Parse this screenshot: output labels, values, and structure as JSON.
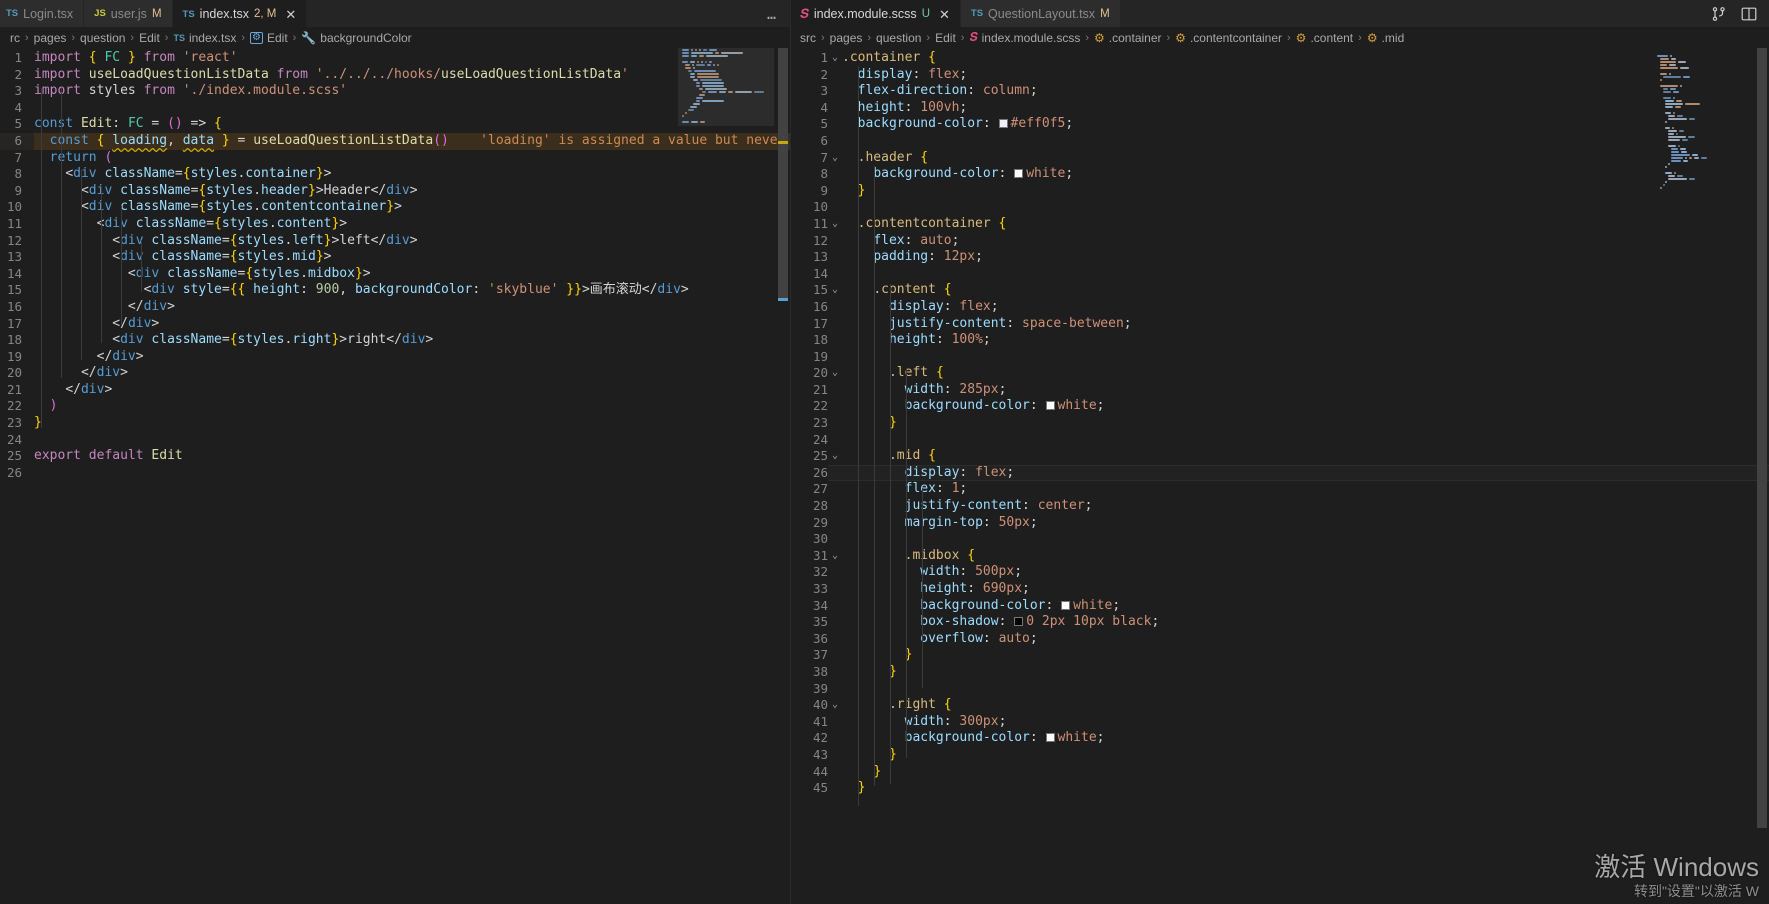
{
  "window": {
    "icons": [
      {
        "name": "source-control-icon",
        "glyph": "source-control"
      },
      {
        "name": "split-editor-icon",
        "glyph": "split-editor"
      }
    ]
  },
  "watermark": {
    "line1": "激活 Windows",
    "line2": "转到\"设置\"以激活 W"
  },
  "left_group": {
    "more_actions_label": "…",
    "tabs": [
      {
        "name": "tab-login-tsx",
        "icon": "ts-file-icon",
        "icon_kind": "ts",
        "label": "Login.tsx",
        "mark": "",
        "active": false,
        "closable": false
      },
      {
        "name": "tab-user-js",
        "icon": "js-file-icon",
        "icon_kind": "js",
        "label": "user.js",
        "mark": "M",
        "mark_kind": "m",
        "active": false,
        "closable": false
      },
      {
        "name": "tab-index-tsx",
        "icon": "ts-file-icon",
        "icon_kind": "ts",
        "label": "index.tsx",
        "mark": "2, M",
        "mark_kind": "m",
        "active": true,
        "closable": true
      }
    ],
    "breadcrumb": [
      {
        "name": "crumb-src",
        "label": "rc",
        "icon": ""
      },
      {
        "name": "crumb-pages",
        "label": "pages",
        "icon": ""
      },
      {
        "name": "crumb-question",
        "label": "question",
        "icon": ""
      },
      {
        "name": "crumb-edit-folder",
        "label": "Edit",
        "icon": ""
      },
      {
        "name": "crumb-index-tsx",
        "label": "index.tsx",
        "icon": "ts"
      },
      {
        "name": "crumb-symbol-edit",
        "label": "Edit",
        "icon": "box"
      },
      {
        "name": "crumb-symbol-backgroundcolor",
        "label": "backgroundColor",
        "icon": "wrench"
      }
    ],
    "warning_text": "'loading' is assigned a value but neve",
    "code": [
      {
        "n": 1,
        "t": "import { FC } from 'react'"
      },
      {
        "n": 2,
        "t": "import useLoadQuestionListData from '../../../hooks/useLoadQuestionListData'"
      },
      {
        "n": 3,
        "t": "import styles from './index.module.scss'"
      },
      {
        "n": 4,
        "t": ""
      },
      {
        "n": 5,
        "t": "const Edit: FC = () => {"
      },
      {
        "n": 6,
        "t": "  const { loading, data } = useLoadQuestionListData()"
      },
      {
        "n": 7,
        "t": "  return ("
      },
      {
        "n": 8,
        "t": "    <div className={styles.container}>"
      },
      {
        "n": 9,
        "t": "      <div className={styles.header}>Header</div>"
      },
      {
        "n": 10,
        "t": "      <div className={styles.contentcontainer}>"
      },
      {
        "n": 11,
        "t": "        <div className={styles.content}>"
      },
      {
        "n": 12,
        "t": "          <div className={styles.left}>left</div>"
      },
      {
        "n": 13,
        "t": "          <div className={styles.mid}>"
      },
      {
        "n": 14,
        "t": "            <div className={styles.midbox}>"
      },
      {
        "n": 15,
        "t": "              <div style={{ height: 900, backgroundColor: 'skyblue' }}>画布滚动</div>"
      },
      {
        "n": 16,
        "t": "            </div>"
      },
      {
        "n": 17,
        "t": "          </div>"
      },
      {
        "n": 18,
        "t": "          <div className={styles.right}>right</div>"
      },
      {
        "n": 19,
        "t": "        </div>"
      },
      {
        "n": 20,
        "t": "      </div>"
      },
      {
        "n": 21,
        "t": "    </div>"
      },
      {
        "n": 22,
        "t": "  )"
      },
      {
        "n": 23,
        "t": "}"
      },
      {
        "n": 24,
        "t": ""
      },
      {
        "n": 25,
        "t": "export default Edit"
      },
      {
        "n": 26,
        "t": ""
      }
    ]
  },
  "right_group": {
    "tabs": [
      {
        "name": "tab-index-module-scss",
        "icon": "scss-file-icon",
        "icon_kind": "scss",
        "label": "index.module.scss",
        "mark": "U",
        "mark_kind": "u",
        "active": true,
        "closable": true
      },
      {
        "name": "tab-questionlayout-tsx",
        "icon": "ts-file-icon",
        "icon_kind": "ts",
        "label": "QuestionLayout.tsx",
        "mark": "M",
        "mark_kind": "m",
        "active": false,
        "closable": false
      }
    ],
    "breadcrumb": [
      {
        "name": "crumb-src",
        "label": "src",
        "icon": ""
      },
      {
        "name": "crumb-pages",
        "label": "pages",
        "icon": ""
      },
      {
        "name": "crumb-question",
        "label": "question",
        "icon": ""
      },
      {
        "name": "crumb-edit-folder",
        "label": "Edit",
        "icon": ""
      },
      {
        "name": "crumb-index-module-scss",
        "label": "index.module.scss",
        "icon": "scss"
      },
      {
        "name": "crumb-selector-container",
        "label": ".container",
        "icon": "css"
      },
      {
        "name": "crumb-selector-contentcontainer",
        "label": ".contentcontainer",
        "icon": "css"
      },
      {
        "name": "crumb-selector-content",
        "label": ".content",
        "icon": "css"
      },
      {
        "name": "crumb-selector-mid",
        "label": ".mid",
        "icon": "css"
      }
    ],
    "cursor_line": 26,
    "code": [
      {
        "n": 1,
        "t": ".container {",
        "fold": true
      },
      {
        "n": 2,
        "t": "  display: flex;"
      },
      {
        "n": 3,
        "t": "  flex-direction: column;"
      },
      {
        "n": 4,
        "t": "  height: 100vh;"
      },
      {
        "n": 5,
        "t": "  background-color: #eff0f5;",
        "swatch": "#eff0f5"
      },
      {
        "n": 6,
        "t": ""
      },
      {
        "n": 7,
        "t": "  .header {",
        "fold": true
      },
      {
        "n": 8,
        "t": "    background-color: white;",
        "swatch": "#ffffff"
      },
      {
        "n": 9,
        "t": "  }"
      },
      {
        "n": 10,
        "t": ""
      },
      {
        "n": 11,
        "t": "  .contentcontainer {",
        "fold": true
      },
      {
        "n": 12,
        "t": "    flex: auto;"
      },
      {
        "n": 13,
        "t": "    padding: 12px;"
      },
      {
        "n": 14,
        "t": ""
      },
      {
        "n": 15,
        "t": "    .content {",
        "fold": true
      },
      {
        "n": 16,
        "t": "      display: flex;"
      },
      {
        "n": 17,
        "t": "      justify-content: space-between;"
      },
      {
        "n": 18,
        "t": "      height: 100%;"
      },
      {
        "n": 19,
        "t": ""
      },
      {
        "n": 20,
        "t": "      .left {",
        "fold": true
      },
      {
        "n": 21,
        "t": "        width: 285px;"
      },
      {
        "n": 22,
        "t": "        background-color: white;",
        "swatch": "#ffffff"
      },
      {
        "n": 23,
        "t": "      }"
      },
      {
        "n": 24,
        "t": ""
      },
      {
        "n": 25,
        "t": "      .mid {",
        "fold": true
      },
      {
        "n": 26,
        "t": "        display: flex;"
      },
      {
        "n": 27,
        "t": "        flex: 1;"
      },
      {
        "n": 28,
        "t": "        justify-content: center;"
      },
      {
        "n": 29,
        "t": "        margin-top: 50px;"
      },
      {
        "n": 30,
        "t": ""
      },
      {
        "n": 31,
        "t": "        .midbox {",
        "fold": true
      },
      {
        "n": 32,
        "t": "          width: 500px;"
      },
      {
        "n": 33,
        "t": "          height: 690px;"
      },
      {
        "n": 34,
        "t": "          background-color: white;",
        "swatch": "#ffffff"
      },
      {
        "n": 35,
        "t": "          box-shadow: 0 2px 10px black;",
        "swatch": "#000000"
      },
      {
        "n": 36,
        "t": "          overflow: auto;"
      },
      {
        "n": 37,
        "t": "        }"
      },
      {
        "n": 38,
        "t": "      }"
      },
      {
        "n": 39,
        "t": ""
      },
      {
        "n": 40,
        "t": "      .right {",
        "fold": true
      },
      {
        "n": 41,
        "t": "        width: 300px;"
      },
      {
        "n": 42,
        "t": "        background-color: white;",
        "swatch": "#ffffff"
      },
      {
        "n": 43,
        "t": "      }"
      },
      {
        "n": 44,
        "t": "    }"
      },
      {
        "n": 45,
        "t": "  }"
      }
    ]
  },
  "colors": {
    "editor_bg": "#1e1e1e",
    "tabbar_bg": "#252526",
    "tab_inactive_bg": "#2d2d2d",
    "accent_modified": "#e2c08d",
    "accent_untracked": "#73c991",
    "warning_bg": "#3b2e1c",
    "warning_fg": "#cc8a54"
  }
}
